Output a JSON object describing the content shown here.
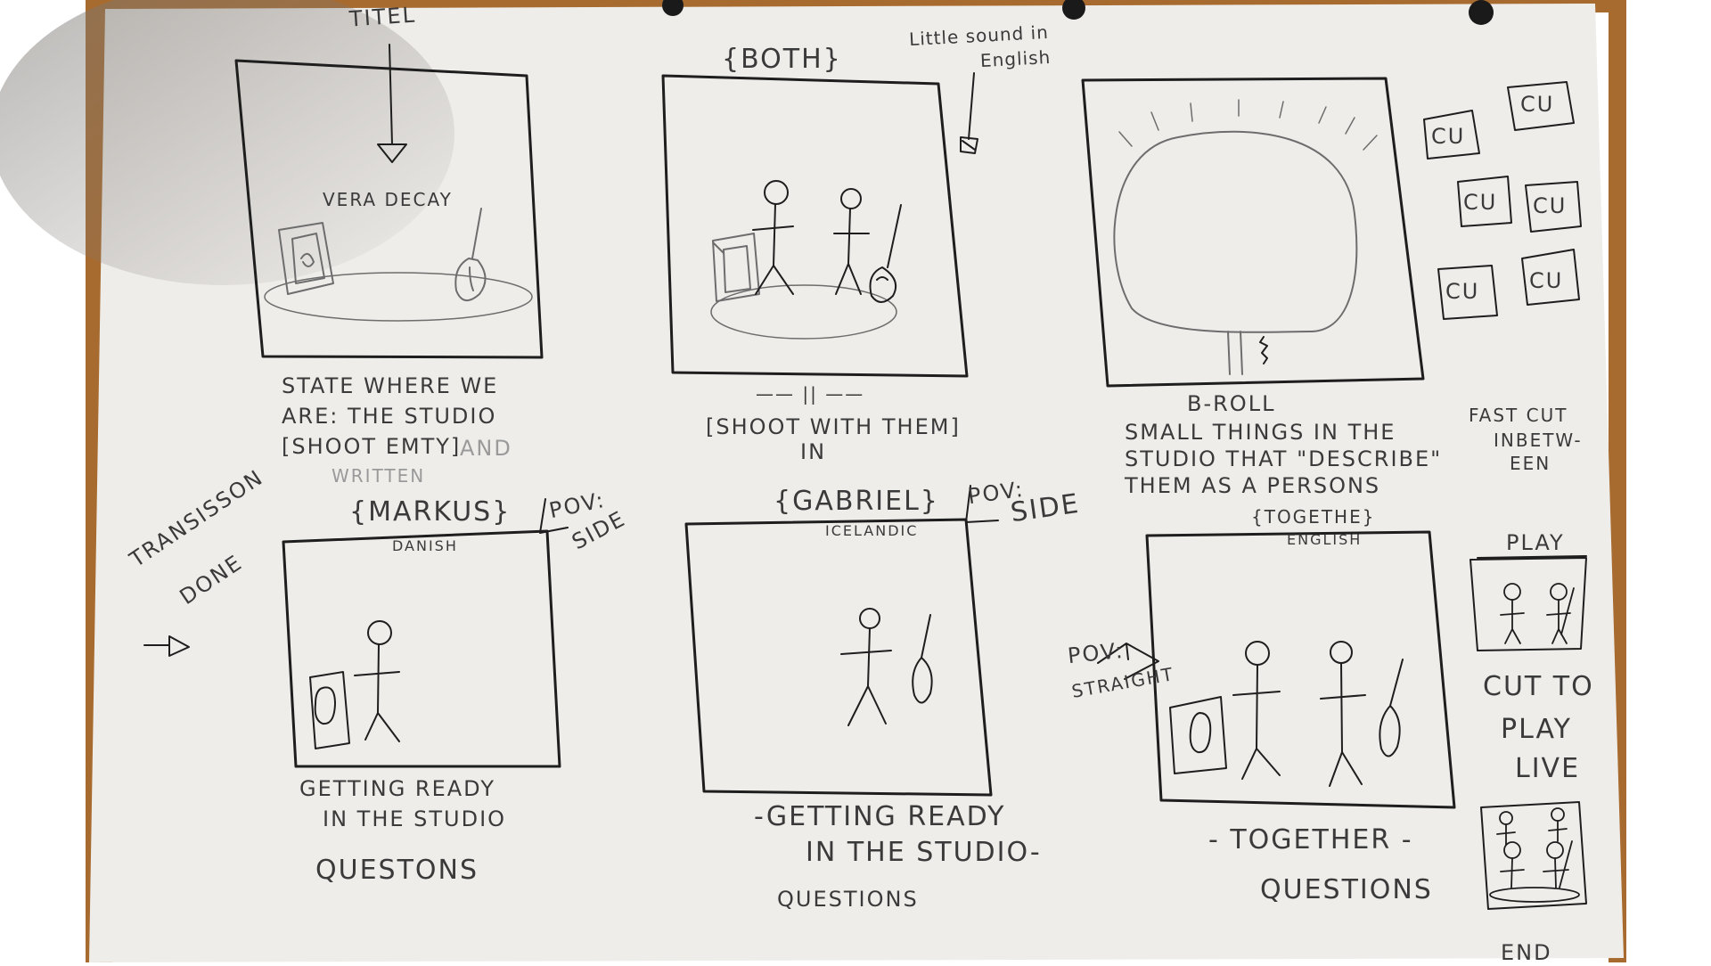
{
  "colors": {
    "table": "#a86b2f",
    "paper": "#efedea",
    "pencil": "#1e1e1e",
    "shadow": "#8a8580"
  },
  "sheet": {
    "title_label": "TITEL",
    "transition_note": [
      "TRANSISSON",
      "DONE"
    ],
    "end_label": "END"
  },
  "top_row": {
    "panel1": {
      "band_name": "VERA DECAY",
      "caption_lines": [
        "STATE WHERE WE",
        "ARE: THE STUDIO",
        "[SHOOT EMTY]"
      ],
      "faint_text": [
        "AND",
        "WRITTEN"
      ]
    },
    "panel2": {
      "tag": "{BOTH}",
      "sound_note": [
        "Little sound in",
        "English"
      ],
      "ditto_mark": "—— || ——",
      "caption_lines": [
        "[SHOOT WITH THEM]",
        "IN"
      ]
    },
    "panel3": {
      "caption_lines": [
        "B-ROLL",
        "SMALL THINGS IN THE",
        "STUDIO THAT \"DESCRIBE\"",
        "THEM AS A PERSONS"
      ]
    },
    "closeups": {
      "labels": [
        "CU",
        "CU",
        "CU",
        "CU",
        "CU",
        "CU"
      ],
      "note": [
        "FAST CUT",
        "INBETW-",
        "EEN"
      ]
    }
  },
  "bottom_row": {
    "panel4": {
      "tag": "{MARKUS}",
      "language": "DANISH",
      "pov": [
        "POV:",
        "SIDE"
      ],
      "caption_lines": [
        "GETTING READY",
        "IN THE STUDIO"
      ],
      "footer": "QUESTONS"
    },
    "panel5": {
      "tag": "{GABRIEL}",
      "language": "ICELANDIC",
      "pov": [
        "POV:",
        "SIDE"
      ],
      "caption_lines": [
        "-GETTING READY",
        "IN THE STUDIO-"
      ],
      "footer": "QUESTIONS"
    },
    "panel6": {
      "tag": "{TOGETHE}",
      "language": "ENGLISH",
      "pov": [
        "POV:",
        "STRAIGHT"
      ],
      "caption_lines": [
        "- TOGETHER -"
      ],
      "footer": "QUESTIONS"
    },
    "side": {
      "play_label": "PLAY",
      "cut_note": [
        "CUT TO",
        "PLAY",
        "LIVE"
      ]
    }
  }
}
